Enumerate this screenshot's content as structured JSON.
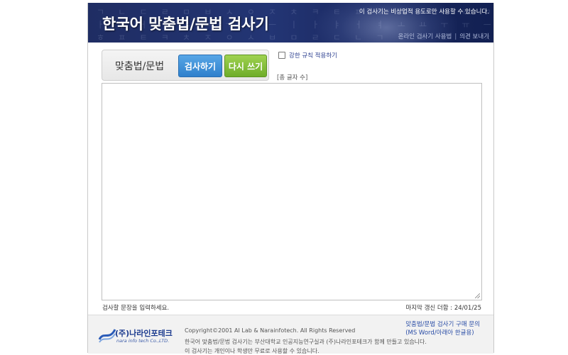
{
  "header": {
    "title": "한국어 맞춤법/문법 검사기",
    "notice": "이 검사기는 비상업적 용도로만 사용할 수 있습니다.",
    "links": [
      "온라인 검사기 사용법",
      "의견 보내기"
    ],
    "separator": "|"
  },
  "toolbar": {
    "tab_label": "맞춤법/문법",
    "check_label": "검사하기",
    "reset_label": "다시 쓰기",
    "strict_label": "강한 규칙 적용하기",
    "char_count": "[총 글자 수]"
  },
  "editor": {
    "value": "",
    "hint": "검사할 문장을 입력하세요.",
    "last_updated": "마지막 갱신 더함 : 24/01/25"
  },
  "footer": {
    "company": "(주)나라인포테크",
    "company_sub": "nara info tech Co.,LTD.",
    "copyright": "Copyright©2001 AI Lab & Narainfotech. All Rights Reserved",
    "desc1": "한국어 맞춤법/문법 검사기는 부산대학교 인공지능연구실과 (주)나라인포테크가 함께 만들고 있습니다.",
    "desc2": "이 검사기는 개인이나 학생만 무료로 사용할 수 있습니다.",
    "purchase_line1": "맞춤법/문법 검사기 구매 문의",
    "purchase_line2": "(MS Word/아래아 한글용)"
  },
  "colors": {
    "header_bg": "#233574",
    "check_button": "#2f80cc",
    "reset_button": "#6fad2a",
    "link": "#2a4da6"
  }
}
